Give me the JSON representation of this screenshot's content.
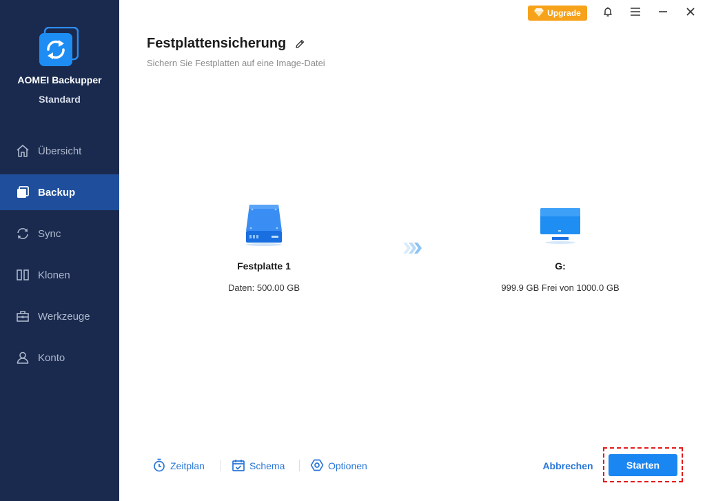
{
  "app": {
    "name": "AOMEI Backupper",
    "edition": "Standard"
  },
  "sidebar": {
    "items": [
      {
        "label": "Übersicht",
        "icon": "home-icon",
        "active": false
      },
      {
        "label": "Backup",
        "icon": "backup-icon",
        "active": true
      },
      {
        "label": "Sync",
        "icon": "sync-icon",
        "active": false
      },
      {
        "label": "Klonen",
        "icon": "clone-icon",
        "active": false
      },
      {
        "label": "Werkzeuge",
        "icon": "toolbox-icon",
        "active": false
      },
      {
        "label": "Konto",
        "icon": "user-icon",
        "active": false
      }
    ]
  },
  "header": {
    "upgrade_label": "Upgrade"
  },
  "main": {
    "title": "Festplattensicherung",
    "subtitle": "Sichern Sie Festplatten auf eine Image-Datei",
    "source": {
      "name": "Festplatte 1",
      "info": "Daten: 500.00 GB"
    },
    "target": {
      "name": "G:",
      "info": "999.9 GB Frei von 1000.0 GB"
    }
  },
  "footer": {
    "schedule_label": "Zeitplan",
    "scheme_label": "Schema",
    "options_label": "Optionen",
    "cancel_label": "Abbrechen",
    "start_label": "Starten"
  },
  "colors": {
    "sidebar_bg": "#1a2a4e",
    "sidebar_active": "#1f4f9c",
    "accent_blue": "#1a86f2",
    "link_blue": "#2776d8",
    "upgrade_orange": "#f7a21b",
    "highlight_red": "#e21a1a"
  }
}
